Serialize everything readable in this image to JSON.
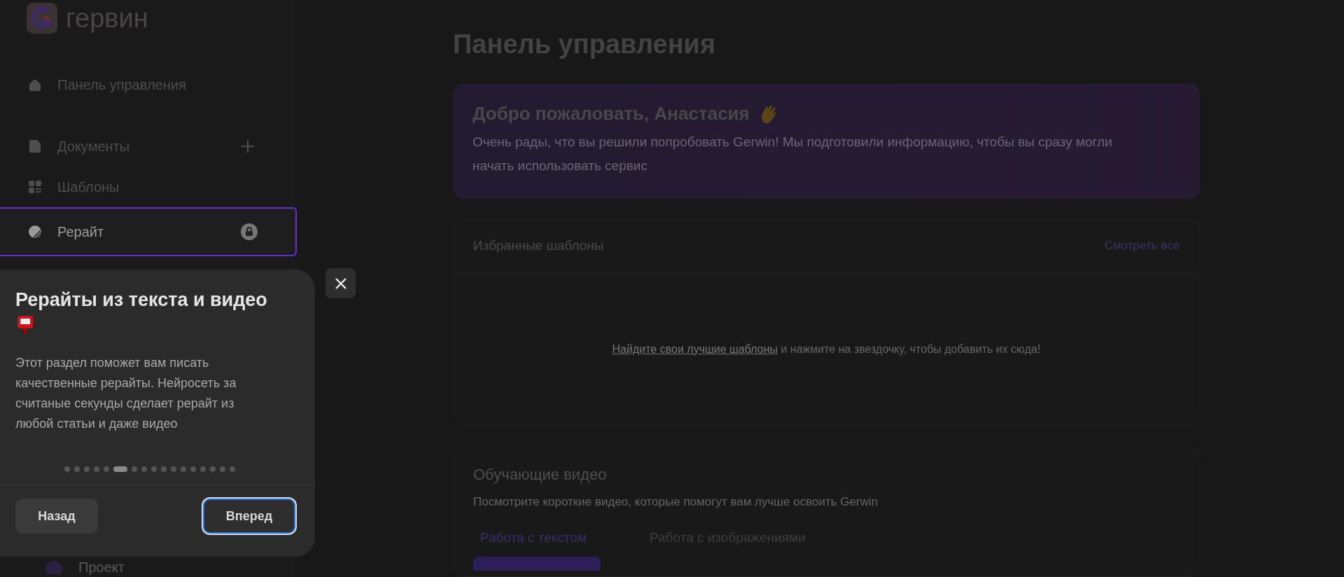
{
  "logo": {
    "name": "гервин"
  },
  "sidebar": {
    "items": [
      {
        "label": "Панель управления",
        "selected": false
      },
      {
        "label": "Документы",
        "selected": false
      },
      {
        "label": "Шаблоны",
        "selected": false
      },
      {
        "label": "Рерайт",
        "selected": true
      },
      {
        "label": "Проект",
        "selected": false
      }
    ]
  },
  "page_title": "Панель управления",
  "welcome": {
    "title": "Добро пожаловать, Анастасия",
    "text": "Очень рады, что вы решили попробовать Gerwin! Мы подготовили информацию, чтобы вы сразу могли начать использовать сервис"
  },
  "favorites": {
    "title": "Избранные шаблоны",
    "view_all": "Смотреть все",
    "empty_link": "Найдите свои лучшие шаблоны",
    "empty_text": " и нажмите на звездочку, чтобы добавить их сюда!"
  },
  "videos": {
    "title": "Обучающие видео",
    "subtitle": "Посмотрите короткие видео, которые помогут вам лучше освоить Gerwin",
    "tabs": [
      {
        "label": "Работа с текстом",
        "selected": true
      },
      {
        "label": "Работа с изображениями",
        "selected": false
      }
    ]
  },
  "tour": {
    "title": "Рерайты из текста и видео",
    "text": "Этот раздел поможет вам писать качественные рерайты. Нейросеть за считаные секунды сделает рерайт из любой статьи и даже видео",
    "steps": [
      {
        "selected": false
      },
      {
        "selected": false
      },
      {
        "selected": false
      },
      {
        "selected": false
      },
      {
        "selected": false
      },
      {
        "selected": true
      },
      {
        "selected": false
      },
      {
        "selected": false
      },
      {
        "selected": false
      },
      {
        "selected": false
      },
      {
        "selected": false
      },
      {
        "selected": false
      },
      {
        "selected": false
      },
      {
        "selected": false
      },
      {
        "selected": false
      },
      {
        "selected": false
      },
      {
        "selected": false
      }
    ],
    "back": "Назад",
    "next": "Вперед"
  }
}
